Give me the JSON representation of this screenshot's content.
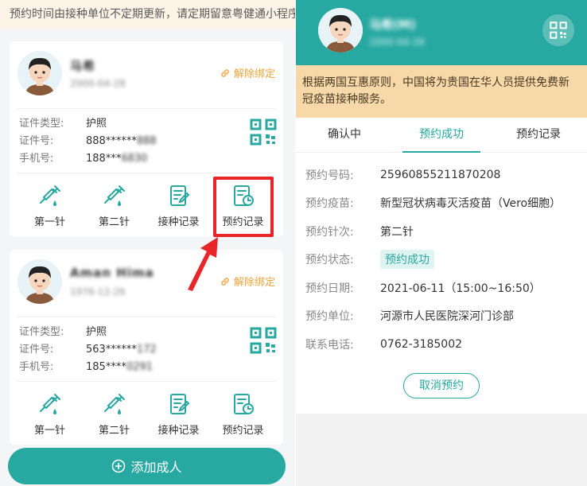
{
  "left": {
    "notice": "预约时间由接种单位不定期更新，请定期留意粤健通小程序",
    "cards": [
      {
        "name": "马希",
        "dob": "2000-04-28",
        "unbind_label": "解除绑定",
        "fields": [
          {
            "label": "证件类型:",
            "value": "护照"
          },
          {
            "label": "证件号:",
            "value": "888******",
            "masked": "888"
          },
          {
            "label": "手机号:",
            "value": "188***",
            "masked": "6830"
          }
        ],
        "actions": [
          "第一针",
          "第二针",
          "接种记录",
          "预约记录"
        ]
      },
      {
        "name": "Aman Hima",
        "dob": "1976-12-26",
        "unbind_label": "解除绑定",
        "fields": [
          {
            "label": "证件类型:",
            "value": "护照"
          },
          {
            "label": "证件号:",
            "value": "563******",
            "masked": "172"
          },
          {
            "label": "手机号:",
            "value": "185****",
            "masked": "0291"
          }
        ],
        "actions": [
          "第一针",
          "第二针",
          "接种记录",
          "预约记录"
        ]
      }
    ],
    "add_button": "添加成人"
  },
  "right": {
    "name": "马希(M)",
    "dob": "2000-04-28",
    "notice": "根据两国互惠原则，中国将为贵国在华人员提供免费新冠疫苗接种服务。",
    "tabs": [
      "确认中",
      "预约成功",
      "预约记录"
    ],
    "active_tab": 1,
    "details": [
      {
        "label": "预约号码:",
        "value": "25960855211870208"
      },
      {
        "label": "预约疫苗:",
        "value": "新型冠状病毒灭活疫苗（Vero细胞）"
      },
      {
        "label": "预约针次:",
        "value": "第二针"
      },
      {
        "label": "预约状态:",
        "value": "预约成功"
      },
      {
        "label": "预约日期:",
        "value": "2021-06-11（15:00~16:50）"
      },
      {
        "label": "预约单位:",
        "value": "河源市人民医院深河门诊部"
      },
      {
        "label": "联系电话:",
        "value": "0762-3185002"
      }
    ],
    "cancel_button": "取消预约"
  },
  "colors": {
    "accent": "#27a8a1",
    "warning": "#f0a43a",
    "highlight": "#e8262a",
    "notice_bg": "#f6d8a9"
  }
}
